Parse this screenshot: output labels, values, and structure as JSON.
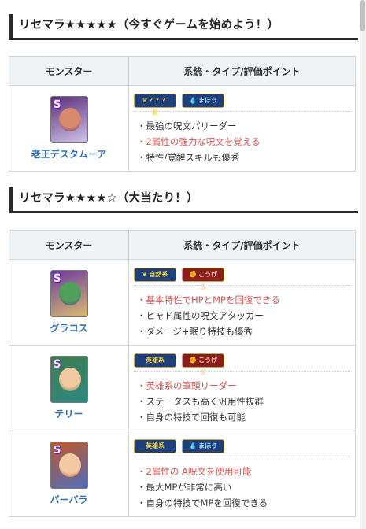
{
  "section1": {
    "title": "リセマラ★★★★★（今すぐゲームを始めよう！）",
    "headers": {
      "monster": "モンスター",
      "info": "系統・タイプ/評価ポイント"
    },
    "rows": [
      {
        "name": "老王デスタムーア",
        "rank": "S",
        "badges": [
          {
            "label": "？？？系",
            "style": "gold",
            "icon": "crown-icon",
            "symbol": "♛"
          },
          {
            "label": "まほう",
            "style": "blue",
            "icon": "magic-drop-icon",
            "symbol": "💧"
          }
        ],
        "points": [
          {
            "text": "最強の呪文パリーダー",
            "highlight": false
          },
          {
            "text": "2属性の強力な呪文を覚える",
            "highlight": true
          },
          {
            "text": "特性/覚醒スキルも優秀",
            "highlight": false
          }
        ],
        "colors": {
          "bg": "#5a2d7a",
          "face": "#d88a6b",
          "accent": "#e8e2ff"
        }
      }
    ]
  },
  "section2": {
    "title": "リセマラ★★★★☆（大当たり！）",
    "headers": {
      "monster": "モンスター",
      "info": "系統・タイプ/評価ポイント"
    },
    "rows": [
      {
        "name": "グラコス",
        "rank": "S",
        "badges": [
          {
            "label": "自然系",
            "style": "gold",
            "icon": "nature-icon",
            "symbol": "❦"
          },
          {
            "label": "こうげき",
            "style": "red",
            "icon": "attack-icon",
            "symbol": "✊"
          }
        ],
        "points": [
          {
            "text": "基本特性でHPとMPを回復できる",
            "highlight": true
          },
          {
            "text": "ヒャド属性の呪文アタッカー",
            "highlight": false
          },
          {
            "text": "ダメージ+眠り特技も優秀",
            "highlight": false
          }
        ],
        "colors": {
          "bg": "#6b3c9e",
          "face": "#4fa05a",
          "accent": "#f0d36a"
        }
      },
      {
        "name": "テリー",
        "rank": "S",
        "badges": [
          {
            "label": "英雄系",
            "style": "gold",
            "icon": "hero-icon",
            "symbol": ""
          },
          {
            "label": "こうげき",
            "style": "red",
            "icon": "attack-icon",
            "symbol": "✊"
          }
        ],
        "points": [
          {
            "text": "英雄系の筆頭リーダー",
            "highlight": true
          },
          {
            "text": "ステータスも高く汎用性抜群",
            "highlight": false
          },
          {
            "text": "自身の特技で回復も可能",
            "highlight": false
          }
        ],
        "colors": {
          "bg": "#3e7c4f",
          "face": "#f1c9a0",
          "accent": "#2a8c8c"
        }
      },
      {
        "name": "バーバラ",
        "rank": "S",
        "badges": [
          {
            "label": "英雄系",
            "style": "gold",
            "icon": "hero-icon",
            "symbol": ""
          },
          {
            "label": "まほう",
            "style": "blue",
            "icon": "magic-drop-icon",
            "symbol": "💧"
          }
        ],
        "points": [
          {
            "text": "2属性の A呪文を使用可能",
            "highlight": true
          },
          {
            "text": "最大MPが非常に高い",
            "highlight": false
          },
          {
            "text": "自身の特技でMPを回復できる",
            "highlight": false
          }
        ],
        "colors": {
          "bg": "#c05a2a",
          "face": "#f2c9a3",
          "accent": "#3a6fd8"
        }
      }
    ]
  }
}
